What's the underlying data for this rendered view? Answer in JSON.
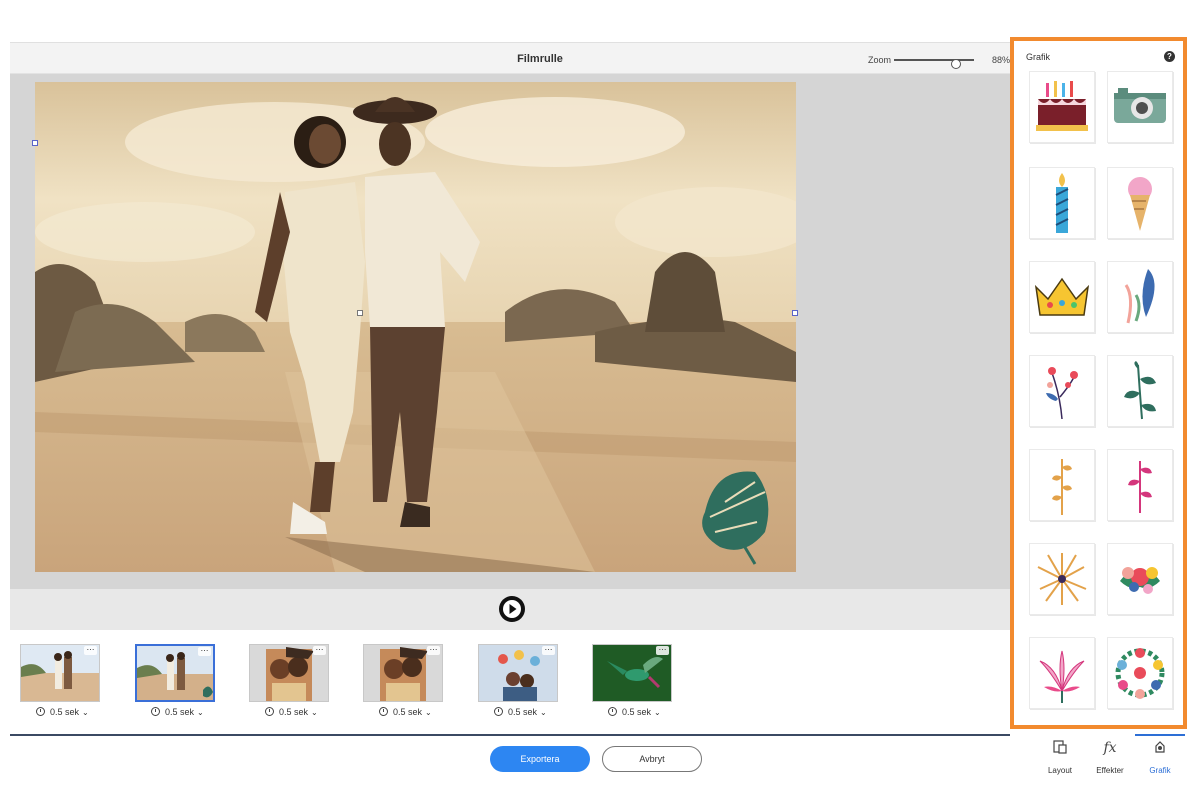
{
  "header": {
    "title": "Filmrulle",
    "zoom_label": "Zoom",
    "zoom_value": "88%",
    "zoom_level": 0.88
  },
  "filmstrip": {
    "clips": [
      {
        "duration": "0.5 sek",
        "selected": false,
        "more": "⋯"
      },
      {
        "duration": "0.5 sek",
        "selected": true,
        "more": "⋯"
      },
      {
        "duration": "0.5 sek",
        "selected": false,
        "more": "⋯"
      },
      {
        "duration": "0.5 sek",
        "selected": false,
        "more": "⋯"
      },
      {
        "duration": "0.5 sek",
        "selected": false,
        "more": "⋯"
      },
      {
        "duration": "0.5 sek",
        "selected": false,
        "more": "⋯"
      }
    ],
    "chevron": "⌄"
  },
  "actions": {
    "export_label": "Exportera",
    "cancel_label": "Avbryt"
  },
  "panel": {
    "title": "Grafik",
    "help": "?",
    "graphics": [
      {
        "icon": "birthday-cake-icon"
      },
      {
        "icon": "camera-icon"
      },
      {
        "icon": "candle-icon"
      },
      {
        "icon": "ice-cream-icon"
      },
      {
        "icon": "crown-icon"
      },
      {
        "icon": "feather-leaves-icon"
      },
      {
        "icon": "berry-branch-icon"
      },
      {
        "icon": "green-leaf-branch-icon"
      },
      {
        "icon": "wheat-sprig-icon"
      },
      {
        "icon": "pink-sprig-icon"
      },
      {
        "icon": "firework-icon"
      },
      {
        "icon": "flower-bouquet-icon"
      },
      {
        "icon": "lotus-flower-icon"
      },
      {
        "icon": "flower-wreath-icon"
      }
    ]
  },
  "tabs": [
    {
      "label": "Layout",
      "icon": "layout-icon",
      "active": false
    },
    {
      "label": "Effekter",
      "icon": "fx-icon",
      "active": false
    },
    {
      "label": "Grafik",
      "icon": "graphics-icon",
      "active": true
    }
  ],
  "colors": {
    "accent": "#2d86f2",
    "panel_border": "#f28a2e",
    "active_tab": "#2d6fd6"
  }
}
